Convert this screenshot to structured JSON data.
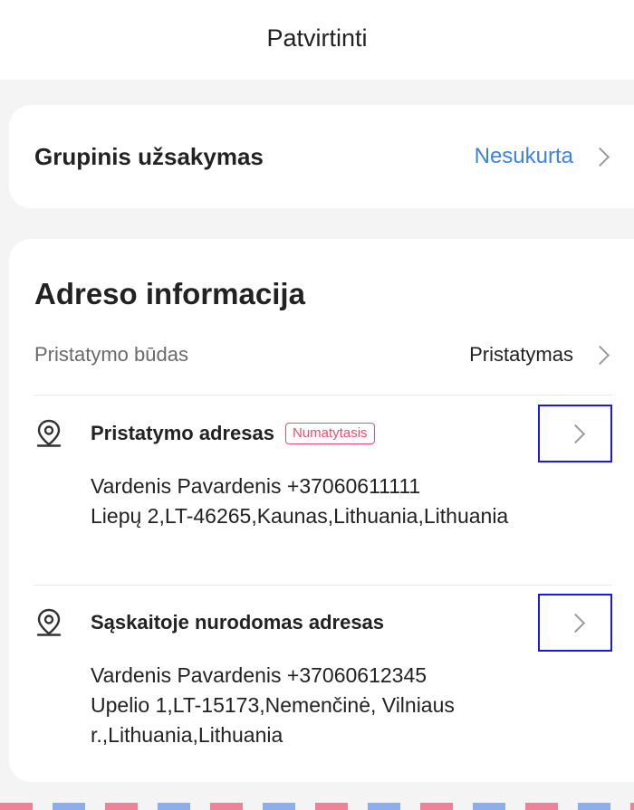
{
  "header": {
    "title": "Patvirtinti"
  },
  "group_order": {
    "label": "Grupinis užsakymas",
    "value": "Nesukurta"
  },
  "address_info": {
    "title": "Adreso informacija",
    "delivery_method": {
      "label": "Pristatymo būdas",
      "value": "Pristatymas"
    },
    "shipping": {
      "title": "Pristatymo adresas",
      "badge": "Numatytasis",
      "line1": "Vardenis Pavardenis +37060611111",
      "line2": "Liepų 2,LT-46265,Kaunas,Lithuania,Lithuania"
    },
    "billing": {
      "title": "Sąskaitoje nurodomas adresas",
      "line1": "Vardenis Pavardenis +37060612345",
      "line2": "Upelio 1,LT-15173,Nemenčinė, Vilniaus r.,Lithuania,Lithuania"
    }
  },
  "icons": {
    "location": "location-pin-icon",
    "chevron": "chevron-right-icon"
  },
  "colors": {
    "link": "#3d82e6",
    "badge": "#ee4d70",
    "highlight": "#1a1ae6"
  }
}
